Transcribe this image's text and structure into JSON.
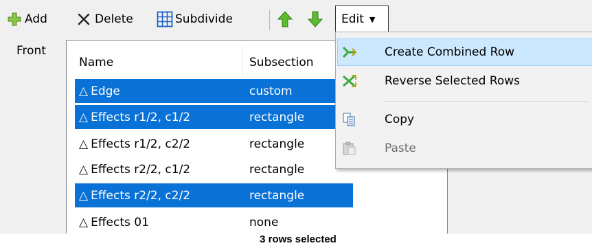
{
  "toolbar": {
    "add_label": "Add",
    "delete_label": "Delete",
    "subdivide_label": "Subdivide",
    "edit_label": "Edit",
    "icons": [
      "add-icon",
      "delete-icon",
      "subdivide-icon",
      "move-up-icon",
      "move-down-icon",
      "chevron-down-icon"
    ],
    "colors": {
      "add": "#8bc34a",
      "arrows": "#4caf2e",
      "subdivide": "#1a62c8"
    }
  },
  "panel": {
    "front_label": "Front"
  },
  "grid": {
    "columns": {
      "name": "Name",
      "subsection": "Subsection"
    },
    "rows": [
      {
        "name": "Edge",
        "subsection": "custom",
        "selected": true
      },
      {
        "name": "Effects r1/2, c1/2",
        "subsection": "rectangle",
        "selected": true
      },
      {
        "name": "Effects r1/2, c2/2",
        "subsection": "rectangle",
        "selected": false
      },
      {
        "name": "Effects r2/2, c1/2",
        "subsection": "rectangle",
        "selected": false
      },
      {
        "name": "Effects r2/2, c2/2",
        "subsection": "rectangle",
        "selected": true
      },
      {
        "name": "Effects 01",
        "subsection": "none",
        "selected": false
      }
    ],
    "row_icon": "triangle-icon",
    "selection_color": "#0a72d6"
  },
  "menu": {
    "items": [
      {
        "label": "Create Combined Row",
        "icon": "combine-rows-icon",
        "highlighted": true,
        "enabled": true
      },
      {
        "label": "Reverse Selected Rows",
        "icon": "reverse-rows-icon",
        "highlighted": false,
        "enabled": true
      },
      {
        "label": "Copy",
        "icon": "copy-icon",
        "highlighted": false,
        "enabled": true
      },
      {
        "label": "Paste",
        "icon": "paste-icon",
        "highlighted": false,
        "enabled": false
      }
    ],
    "highlight_color": "#cce8ff"
  },
  "status": {
    "text": "3 rows selected"
  }
}
